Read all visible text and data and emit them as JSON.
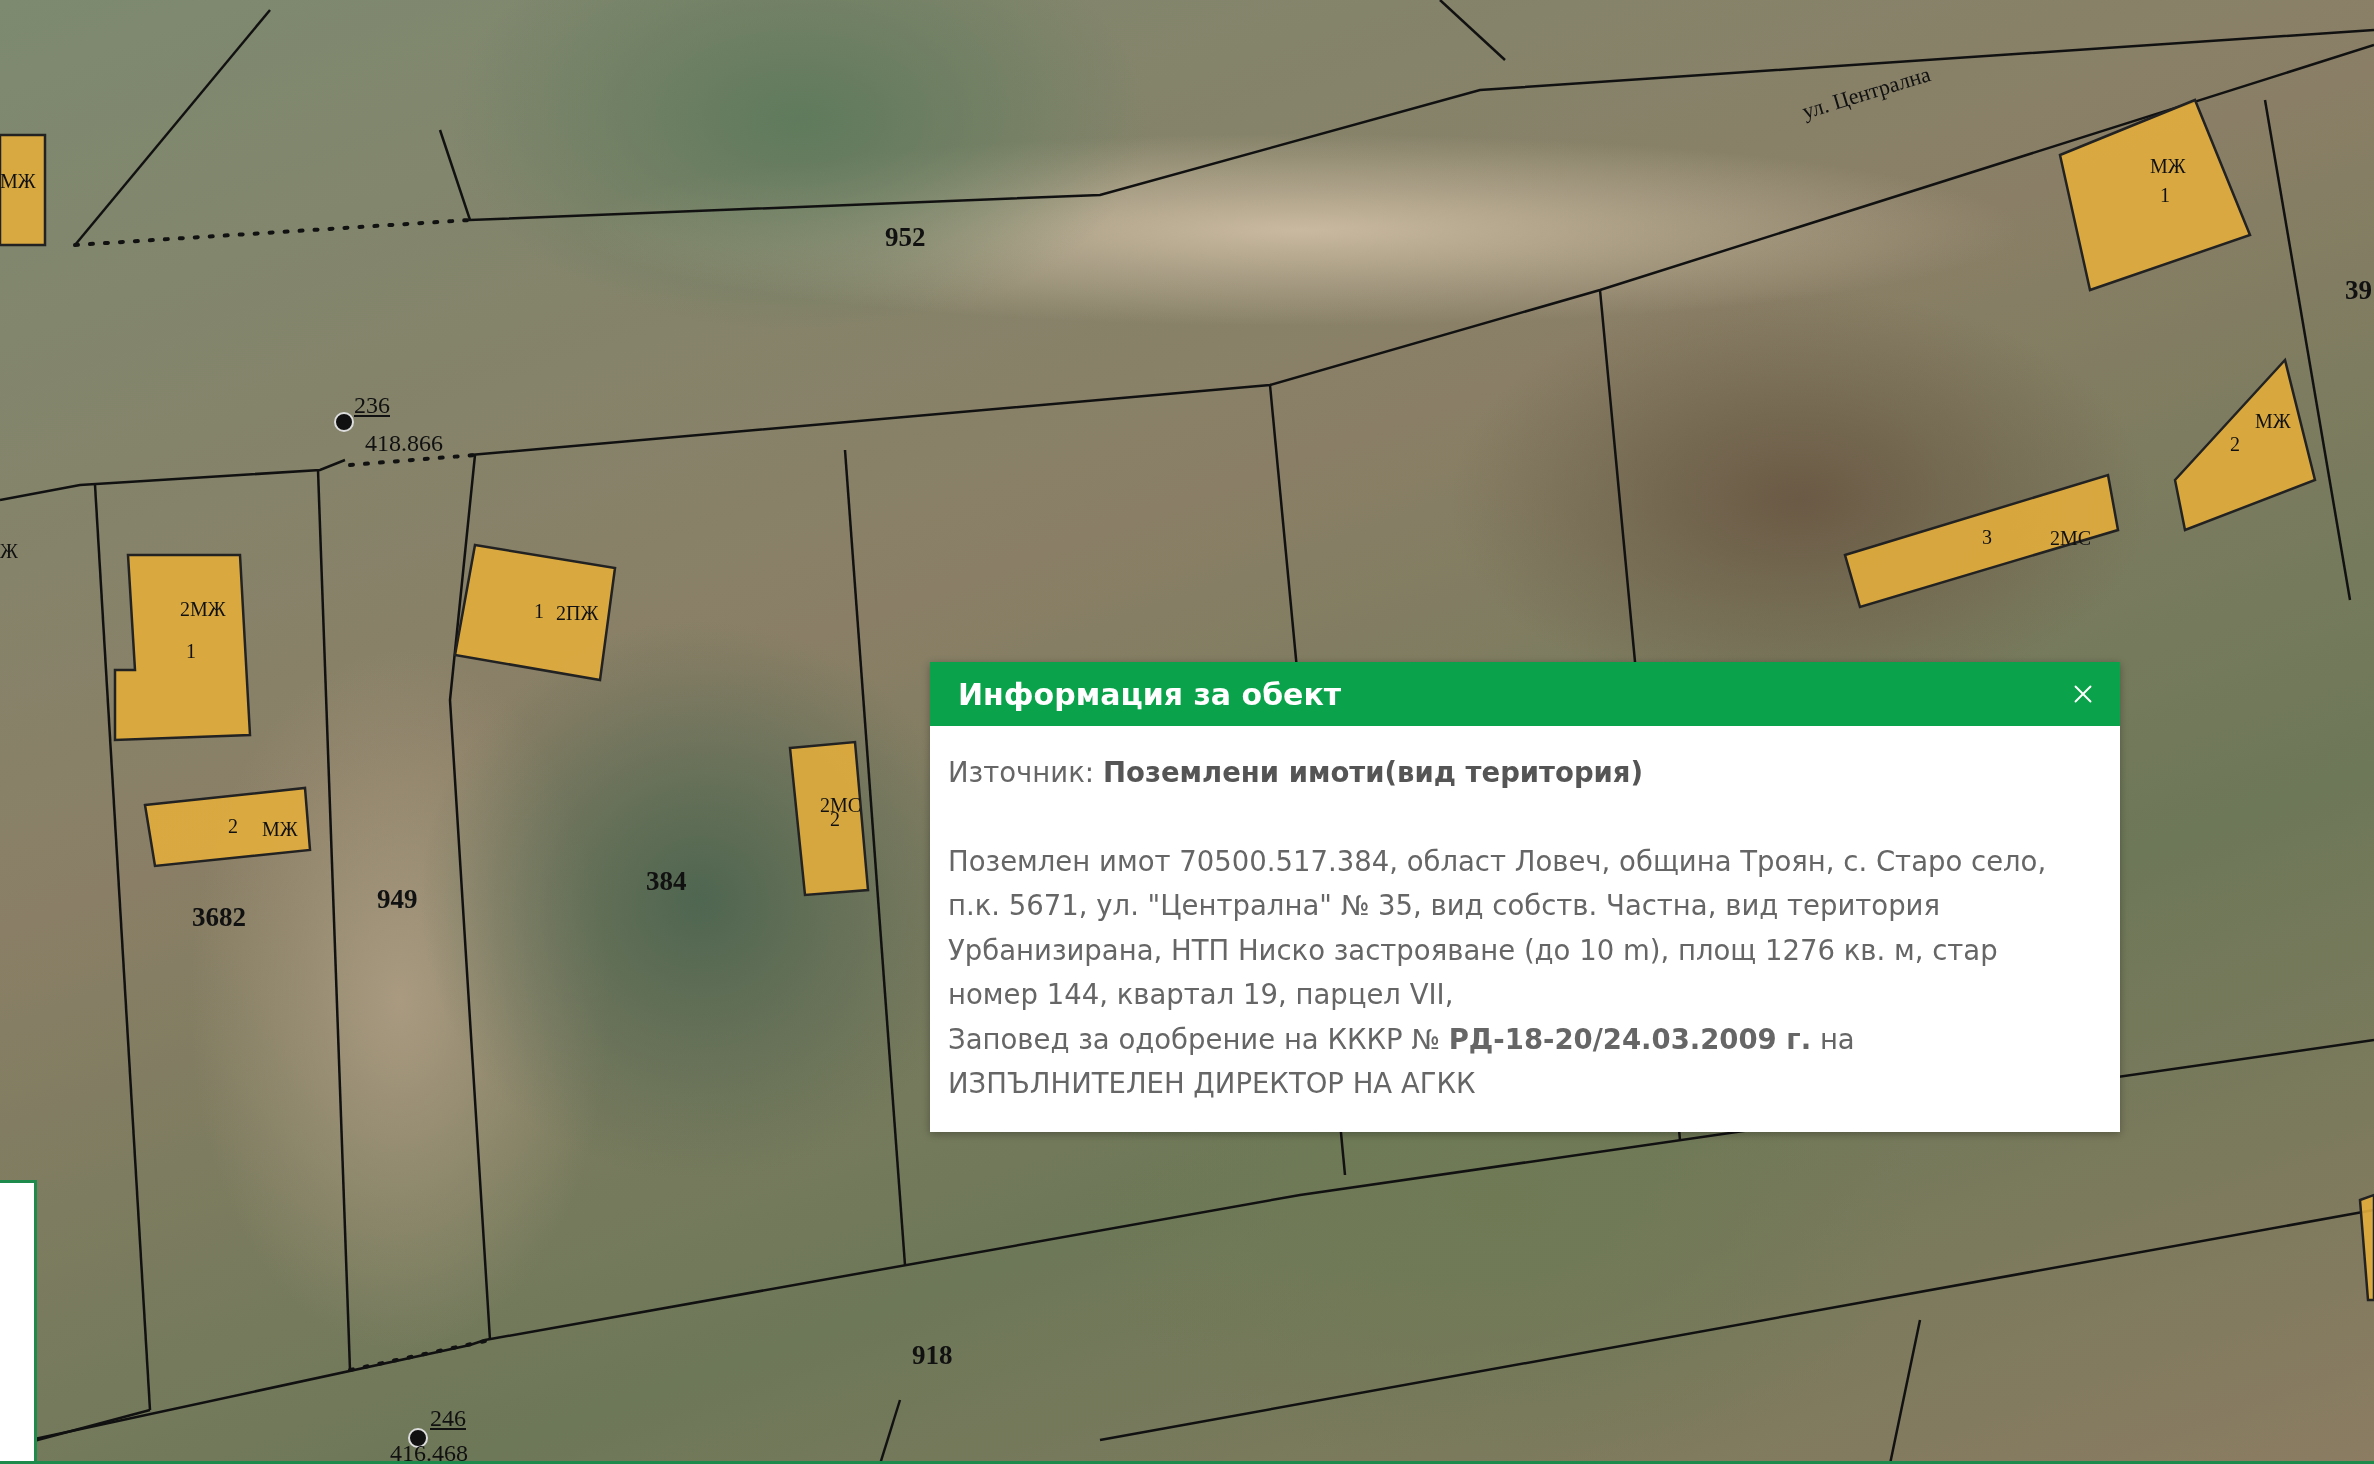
{
  "map": {
    "labels": [
      {
        "text": "952",
        "kind": "parcel"
      },
      {
        "text": "ул. Централна",
        "kind": "street"
      },
      {
        "text": "236",
        "kind": "point"
      },
      {
        "text": "418.866",
        "kind": "elevation"
      },
      {
        "text": "МЖ",
        "kind": "building"
      },
      {
        "text": "Ж",
        "kind": "building"
      },
      {
        "text": "2МЖ",
        "kind": "building"
      },
      {
        "text": "1",
        "kind": "building"
      },
      {
        "text": "2",
        "kind": "building"
      },
      {
        "text": "МЖ",
        "kind": "building"
      },
      {
        "text": "3682",
        "kind": "parcel"
      },
      {
        "text": "949",
        "kind": "parcel"
      },
      {
        "text": "1",
        "kind": "building"
      },
      {
        "text": "2ПЖ",
        "kind": "building"
      },
      {
        "text": "2МС",
        "kind": "building"
      },
      {
        "text": "2",
        "kind": "building"
      },
      {
        "text": "384",
        "kind": "parcel"
      },
      {
        "text": "918",
        "kind": "parcel"
      },
      {
        "text": "246",
        "kind": "point"
      },
      {
        "text": "416.468",
        "kind": "elevation"
      },
      {
        "text": "МЖ",
        "kind": "building"
      },
      {
        "text": "1",
        "kind": "building"
      },
      {
        "text": "39",
        "kind": "parcel"
      },
      {
        "text": "МЖ",
        "kind": "building"
      },
      {
        "text": "2",
        "kind": "building"
      },
      {
        "text": "3",
        "kind": "building"
      },
      {
        "text": "2МС",
        "kind": "building"
      }
    ]
  },
  "info_popup": {
    "title": "Информация за обект",
    "source_label": "Източник:",
    "source_value": "Поземлени имоти(вид територия)",
    "description": "Поземлен имот 70500.517.384, област Ловеч, община Троян, с. Старо село, п.к. 5671, ул. \"Централна\" № 35, вид собств. Частна, вид територия Урбанизирана, НТП Ниско застрояване (до 10 m), площ 1276 кв. м, стар номер 144, квартал 19, парцел VII,",
    "order": "Заповед за одобрение на КККР № **РД-18-20/24.03.2009 г.** на ИЗПЪЛНИТЕЛЕН ДИРЕКТОР НА АГКК"
  }
}
